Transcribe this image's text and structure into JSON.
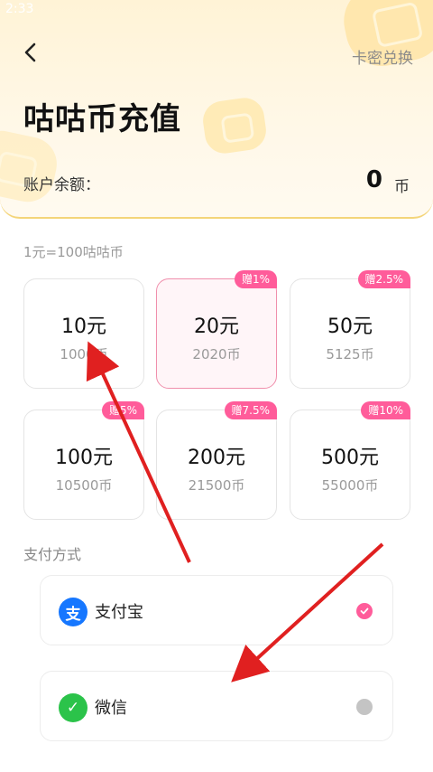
{
  "status": {
    "time": "2:33"
  },
  "header": {
    "back_icon": "chevron-left-icon",
    "redeem_label": "卡密兑换",
    "title": "咕咕币充值",
    "balance_label": "账户余额：",
    "balance_value": "0",
    "balance_unit": "币"
  },
  "rate_note": "1元=100咕咕币",
  "packages": [
    {
      "price": "10元",
      "coins": "1000币",
      "bonus": "",
      "selected": false
    },
    {
      "price": "20元",
      "coins": "2020币",
      "bonus": "赠1%",
      "selected": true
    },
    {
      "price": "50元",
      "coins": "5125币",
      "bonus": "赠2.5%",
      "selected": false
    },
    {
      "price": "100元",
      "coins": "10500币",
      "bonus": "赠5%",
      "selected": false
    },
    {
      "price": "200元",
      "coins": "21500币",
      "bonus": "赠7.5%",
      "selected": false
    },
    {
      "price": "500元",
      "coins": "55000币",
      "bonus": "赠10%",
      "selected": false
    }
  ],
  "payment": {
    "title": "支付方式",
    "methods": [
      {
        "label": "支付宝",
        "icon": "alipay-icon",
        "icon_glyph": "支",
        "color": "#1677ff",
        "selected": true
      },
      {
        "label": "微信",
        "icon": "wechat-pay-icon",
        "icon_glyph": "✓",
        "color": "#2bc34a",
        "selected": false
      }
    ]
  },
  "colors": {
    "accent": "#ff5c9a",
    "annotation_arrow": "#e02020",
    "header_bg": "#fff3d6"
  }
}
